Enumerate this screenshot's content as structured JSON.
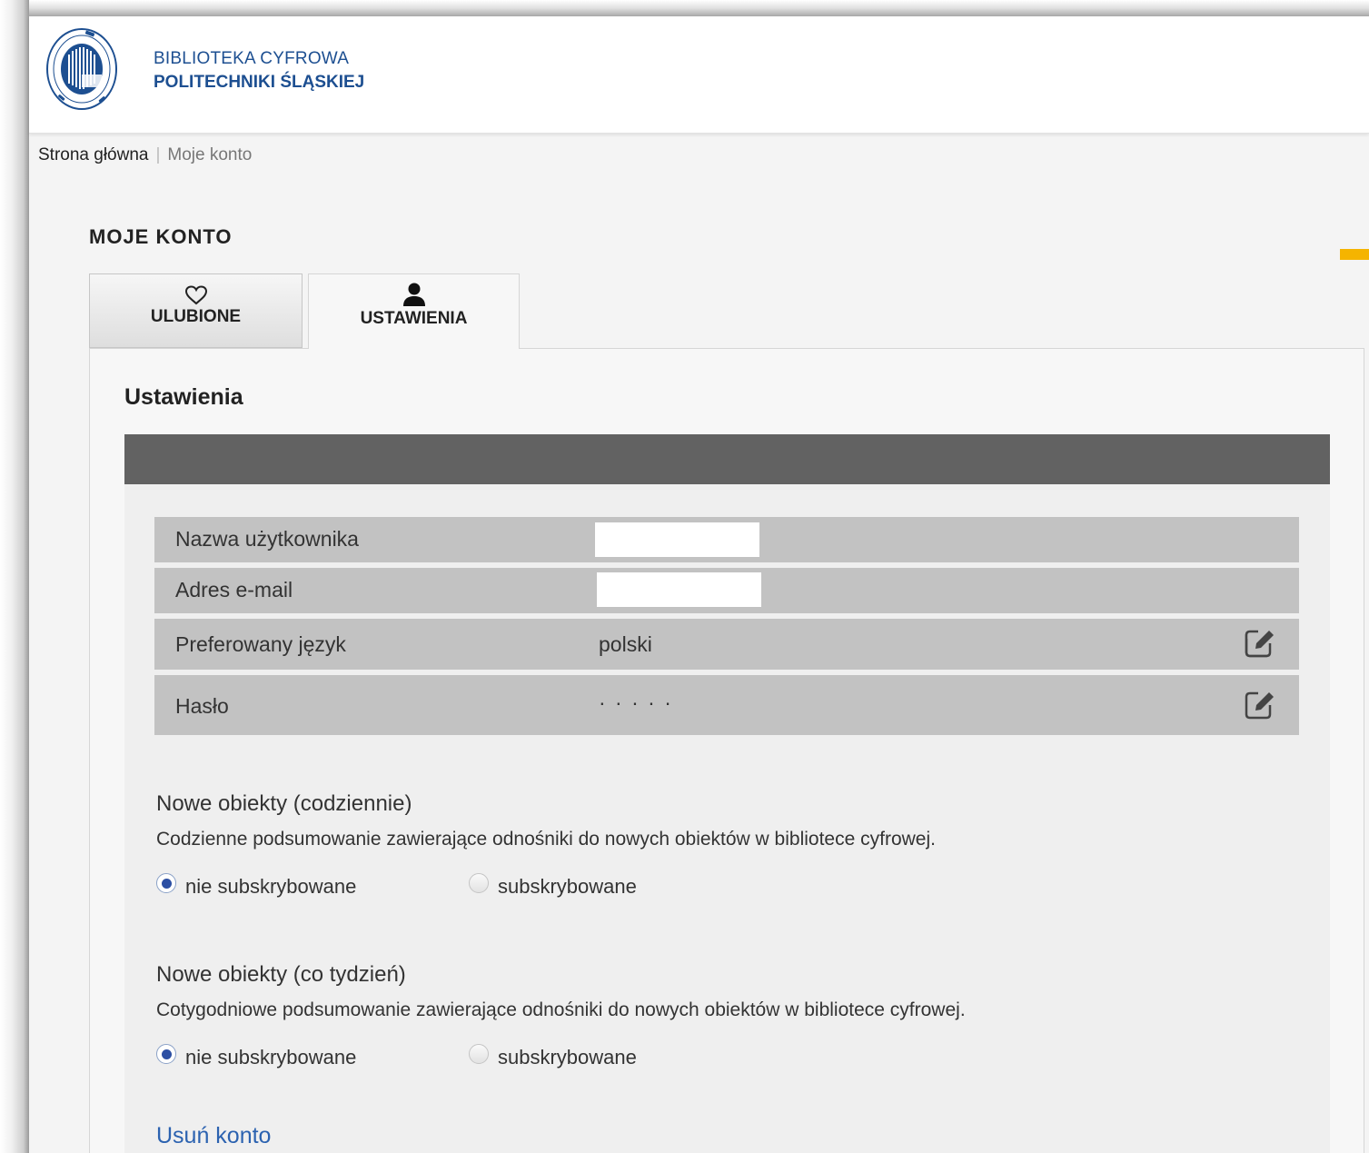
{
  "header": {
    "logo_line1": "BIBLIOTEKA CYFROWA",
    "logo_line2": "POLITECHNIKI ŚLĄSKIEJ"
  },
  "breadcrumb": {
    "home": "Strona główna",
    "separator": "|",
    "current": "Moje konto"
  },
  "page_title": "MOJE KONTO",
  "tabs": [
    {
      "label": "ULUBIONE",
      "icon": "heart-icon"
    },
    {
      "label": "USTAWIENIA",
      "icon": "user-icon",
      "active": true
    }
  ],
  "section_title": "Ustawienia",
  "account_rows": [
    {
      "label": "Nazwa użytkownika",
      "value": ""
    },
    {
      "label": "Adres e-mail",
      "value": ""
    },
    {
      "label": "Preferowany język",
      "value": "polski",
      "editable": true
    },
    {
      "label": "Hasło",
      "value": "· · · · ·",
      "editable": true
    }
  ],
  "subscriptions": [
    {
      "title": "Nowe obiekty (codziennie)",
      "description": "Codzienne podsumowanie zawierające odnośniki do nowych obiektów w bibliotece cyfrowej.",
      "option_off": "nie subskrybowane",
      "option_on": "subskrybowane",
      "selected": "nie subskrybowane"
    },
    {
      "title": "Nowe obiekty (co tydzień)",
      "description": "Cotygodniowe podsumowanie zawierające odnośniki do nowych obiektów w bibliotece cyfrowej.",
      "option_off": "nie subskrybowane",
      "option_on": "subskrybowane",
      "selected": "nie subskrybowane"
    }
  ],
  "delete_account": "Usuń konto",
  "colors": {
    "brand_blue": "#1d4f91",
    "link_blue": "#2b62b0",
    "accent_yellow": "#f5b400",
    "dark_bar": "#626262",
    "row_gray": "#c2c2c2"
  }
}
